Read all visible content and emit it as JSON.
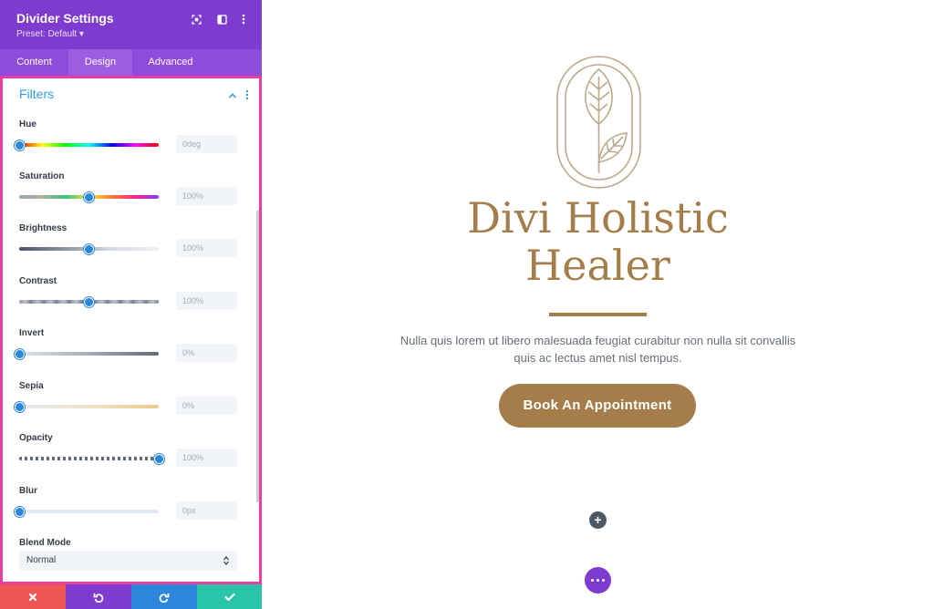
{
  "panel": {
    "title": "Divider Settings",
    "preset": "Preset: Default ▾",
    "header_icons": [
      "fullscreen-icon",
      "split-view-icon",
      "more-vertical-icon"
    ]
  },
  "tabs": [
    {
      "label": "Content",
      "active": false
    },
    {
      "label": "Design",
      "active": true
    },
    {
      "label": "Advanced",
      "active": false
    }
  ],
  "section": {
    "title": "Filters"
  },
  "filters": [
    {
      "label": "Hue",
      "value": "0deg",
      "position": 0.0
    },
    {
      "label": "Saturation",
      "value": "100%",
      "position": 0.5
    },
    {
      "label": "Brightness",
      "value": "100%",
      "position": 0.5
    },
    {
      "label": "Contrast",
      "value": "100%",
      "position": 0.5
    },
    {
      "label": "Invert",
      "value": "0%",
      "position": 0.0
    },
    {
      "label": "Sepia",
      "value": "0%",
      "position": 0.0
    },
    {
      "label": "Opacity",
      "value": "100%",
      "position": 1.0
    },
    {
      "label": "Blur",
      "value": "0px",
      "position": 0.0
    }
  ],
  "blend_mode": {
    "label": "Blend Mode",
    "value": "Normal"
  },
  "bottom_bar": [
    {
      "icon": "close-icon",
      "color": "#ef5555"
    },
    {
      "icon": "undo-icon",
      "color": "#7e3bd0"
    },
    {
      "icon": "redo-icon",
      "color": "#2b87da"
    },
    {
      "icon": "check-icon",
      "color": "#29c4a9"
    }
  ],
  "hero": {
    "title_line1": "Divi Holistic",
    "title_line2": "Healer",
    "description": "Nulla quis lorem ut libero malesuada feugiat curabitur non nulla sit convallis quis ac lectus amet nisl tempus.",
    "cta_label": "Book An Appointment",
    "accent_color": "#a57d4a"
  },
  "canvas_controls": {
    "add": "+"
  },
  "colors": {
    "brand_purple": "#7e3bd0",
    "highlight_pink": "#e83ea3",
    "link_blue": "#2f9fe0",
    "knob_blue": "#2b87da"
  }
}
